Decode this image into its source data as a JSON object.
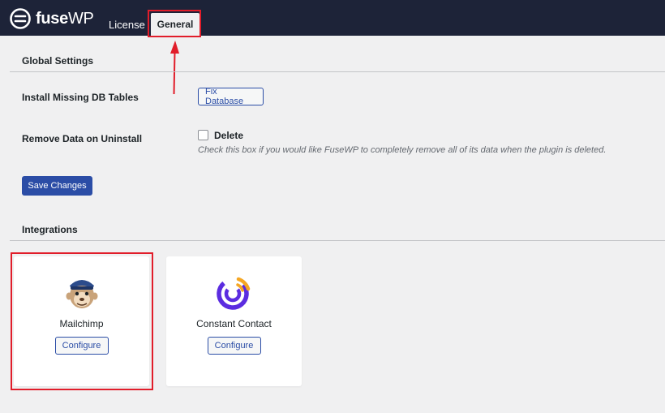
{
  "header": {
    "brand_bold": "fuse",
    "brand_light": "WP",
    "tabs": [
      {
        "label": "License"
      },
      {
        "label": "General"
      }
    ],
    "active_tab": "General",
    "logo_icon": "fusewp-logo-icon"
  },
  "global_settings": {
    "title": "Global Settings",
    "db_row": {
      "label": "Install Missing DB Tables",
      "button_label": "Fix Database"
    },
    "uninstall_row": {
      "label": "Remove Data on Uninstall",
      "checkbox_label": "Delete",
      "checked": false,
      "help_text": "Check this box if you would like FuseWP to completely remove all of its data when the plugin is deleted."
    },
    "save_label": "Save Changes"
  },
  "integrations": {
    "title": "Integrations",
    "items": [
      {
        "name": "Mailchimp",
        "button_label": "Configure",
        "icon": "mailchimp-logo-icon"
      },
      {
        "name": "Constant Contact",
        "button_label": "Configure",
        "icon": "constant-contact-logo-icon"
      }
    ]
  },
  "colors": {
    "topbar": "#1d2338",
    "accent": "#2b4da6",
    "annotation": "#e11d2a",
    "background": "#f0f0f1"
  }
}
